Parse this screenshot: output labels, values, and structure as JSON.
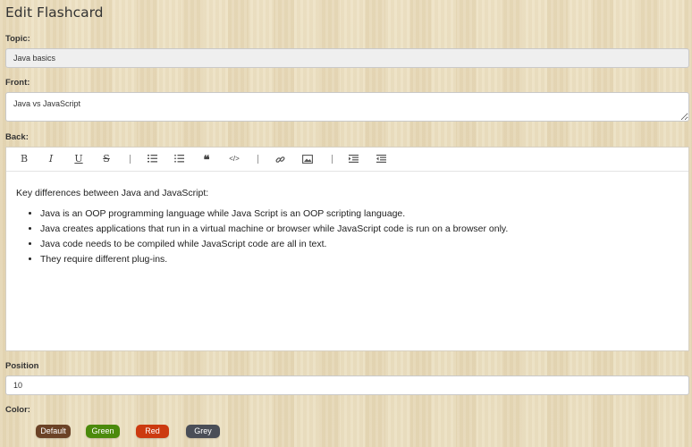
{
  "form": {
    "title": "Edit Flashcard",
    "topic_label": "Topic:",
    "topic_value": "Java basics",
    "front_label": "Front:",
    "front_value": "Java vs JavaScript",
    "back_label": "Back:",
    "position_label": "Position",
    "position_value": "10",
    "color_label": "Color:"
  },
  "toolbar": {
    "buttons": [
      "bold-icon",
      "italic-icon",
      "underline-icon",
      "strikethrough-icon",
      "ordered-list-icon",
      "bullet-list-icon",
      "quote-icon",
      "code-icon",
      "link-icon",
      "image-icon",
      "indent-icon",
      "outdent-icon"
    ]
  },
  "editor": {
    "intro": "Key differences between Java and JavaScript:",
    "bullets": [
      "Java is an OOP programming language while Java Script is an OOP scripting language.",
      "Java creates applications that run in a virtual machine or browser while JavaScript code is run on a browser only.",
      "Java code needs to be compiled while JavaScript code are all in text.",
      "They require different plug-ins."
    ]
  },
  "colors": [
    {
      "label": "Default",
      "color": "#6b4226"
    },
    {
      "label": "Green",
      "color": "#4b8a0c"
    },
    {
      "label": "Red",
      "color": "#cc3a10"
    },
    {
      "label": "Grey",
      "color": "#4a4e57"
    }
  ]
}
